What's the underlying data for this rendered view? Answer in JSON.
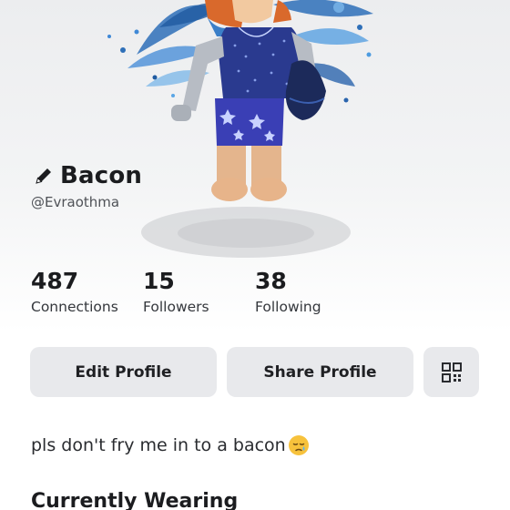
{
  "profile": {
    "display_name": "Bacon",
    "username": "@Evraothma",
    "bio": "pls don't fry me in to a bacon",
    "bio_emoji": "sad-relieved-face-emoji"
  },
  "stats": [
    {
      "value": "487",
      "label": "Connections"
    },
    {
      "value": "15",
      "label": "Followers"
    },
    {
      "value": "38",
      "label": "Following"
    }
  ],
  "actions": {
    "edit_label": "Edit Profile",
    "share_label": "Share Profile",
    "qr_icon": "qr-code-icon"
  },
  "sections": {
    "currently_wearing": "Currently Wearing"
  },
  "icons": {
    "edit": "pencil-icon"
  },
  "colors": {
    "button_bg": "#e8e9ec",
    "text_primary": "#1b1c1f",
    "text_secondary": "#4f5257"
  }
}
